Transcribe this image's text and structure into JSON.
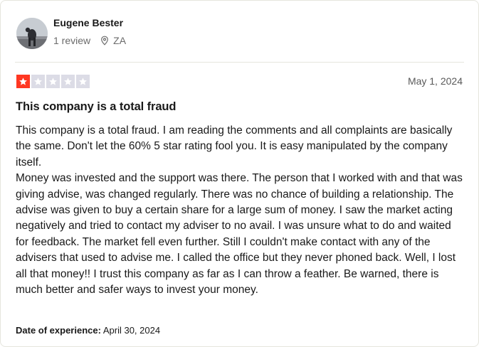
{
  "reviewer": {
    "name": "Eugene Bester",
    "review_count": "1 review",
    "country": "ZA"
  },
  "rating": {
    "stars": 1,
    "max": 5
  },
  "date_posted": "May 1, 2024",
  "review": {
    "title": "This company is a total fraud",
    "paragraphs": [
      "This company is a total fraud. I am reading the comments and all complaints are basically the same. Don't let the 60% 5 star rating fool you. It is easy manipulated by the company itself.",
      "Money was invested and the support was there. The person that I worked with and that was giving advise, was changed regularly. There was no chance of building a relationship. The advise was given to buy a certain share for a large sum of money. I saw the market acting negatively and tried to contact my adviser to no avail. I was unsure what to do and waited for feedback. The market fell even further. Still I couldn't make contact with any of the advisers that used to advise me. I called the office but they never phoned back. Well, I lost all that money!! I trust this company as far as I can throw a feather. Be warned, there is much better and safer ways to invest your money."
    ]
  },
  "experience": {
    "label": "Date of experience:",
    "date": "April 30, 2024"
  },
  "icons": {
    "location": "location-pin-icon",
    "star": "star-icon"
  },
  "colors": {
    "star_active": "#ff3722",
    "star_inactive": "#dcdce6",
    "text": "#191919",
    "muted": "#6b6b6b"
  }
}
